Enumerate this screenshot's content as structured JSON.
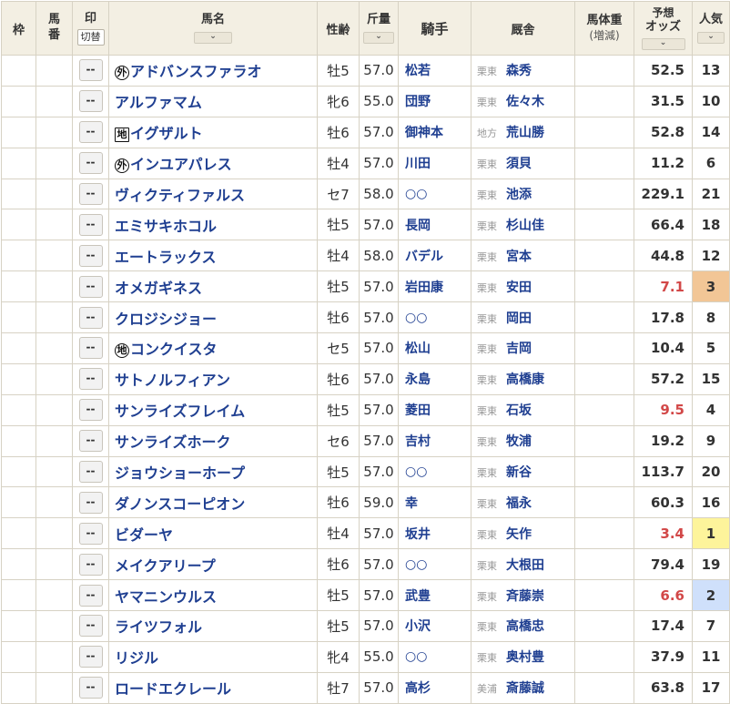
{
  "headers": {
    "waku": "枠",
    "umaban": "馬\n番",
    "mark": "印",
    "mark_toggle": "切替",
    "horse_name": "馬名",
    "sex_age": "性齢",
    "weight": "斤量",
    "jockey": "騎手",
    "stable": "厩舎",
    "body_weight": "馬体重",
    "body_weight_sub": "(増減)",
    "odds_top": "予想",
    "odds_bottom": "オッズ",
    "popularity": "人気",
    "sort_icon": "chevron-down-icon"
  },
  "mark_default": "--",
  "colors": {
    "link_blue": "#1f3f91",
    "odds_hot": "#d24848",
    "pop1": "#fdf49b",
    "pop2": "#cfe0fb",
    "pop3": "#f2c696",
    "header_bg": "#f3efe3"
  },
  "rows": [
    {
      "badge": "外",
      "badge_shape": "circle",
      "name": "アドバンスファラオ",
      "sex_age": "牡5",
      "weight": "57.0",
      "jockey": "松若",
      "region": "栗東",
      "trainer": "森秀",
      "odds": "52.5",
      "pop": "13",
      "hot": false,
      "pop_class": ""
    },
    {
      "badge": "",
      "badge_shape": "",
      "name": "アルファマム",
      "sex_age": "牝6",
      "weight": "55.0",
      "jockey": "団野",
      "region": "栗東",
      "trainer": "佐々木",
      "odds": "31.5",
      "pop": "10",
      "hot": false,
      "pop_class": ""
    },
    {
      "badge": "地",
      "badge_shape": "square",
      "name": "イグザルト",
      "sex_age": "牡6",
      "weight": "57.0",
      "jockey": "御神本",
      "region": "地方",
      "trainer": "荒山勝",
      "odds": "52.8",
      "pop": "14",
      "hot": false,
      "pop_class": ""
    },
    {
      "badge": "外",
      "badge_shape": "circle",
      "name": "インユアパレス",
      "sex_age": "牡4",
      "weight": "57.0",
      "jockey": "川田",
      "region": "栗東",
      "trainer": "須貝",
      "odds": "11.2",
      "pop": "6",
      "hot": false,
      "pop_class": ""
    },
    {
      "badge": "",
      "badge_shape": "",
      "name": "ヴィクティファルス",
      "sex_age": "セ7",
      "weight": "58.0",
      "jockey": "○○",
      "region": "栗東",
      "trainer": "池添",
      "odds": "229.1",
      "pop": "21",
      "hot": false,
      "pop_class": ""
    },
    {
      "badge": "",
      "badge_shape": "",
      "name": "エミサキホコル",
      "sex_age": "牡5",
      "weight": "57.0",
      "jockey": "長岡",
      "region": "栗東",
      "trainer": "杉山佳",
      "odds": "66.4",
      "pop": "18",
      "hot": false,
      "pop_class": ""
    },
    {
      "badge": "",
      "badge_shape": "",
      "name": "エートラックス",
      "sex_age": "牡4",
      "weight": "58.0",
      "jockey": "バデル",
      "region": "栗東",
      "trainer": "宮本",
      "odds": "44.8",
      "pop": "12",
      "hot": false,
      "pop_class": ""
    },
    {
      "badge": "",
      "badge_shape": "",
      "name": "オメガギネス",
      "sex_age": "牡5",
      "weight": "57.0",
      "jockey": "岩田康",
      "region": "栗東",
      "trainer": "安田",
      "odds": "7.1",
      "pop": "3",
      "hot": true,
      "pop_class": "p3"
    },
    {
      "badge": "",
      "badge_shape": "",
      "name": "クロジシジョー",
      "sex_age": "牡6",
      "weight": "57.0",
      "jockey": "○○",
      "region": "栗東",
      "trainer": "岡田",
      "odds": "17.8",
      "pop": "8",
      "hot": false,
      "pop_class": ""
    },
    {
      "badge": "地",
      "badge_shape": "circle",
      "name": "コンクイスタ",
      "sex_age": "セ5",
      "weight": "57.0",
      "jockey": "松山",
      "region": "栗東",
      "trainer": "吉岡",
      "odds": "10.4",
      "pop": "5",
      "hot": false,
      "pop_class": ""
    },
    {
      "badge": "",
      "badge_shape": "",
      "name": "サトノルフィアン",
      "sex_age": "牡6",
      "weight": "57.0",
      "jockey": "永島",
      "region": "栗東",
      "trainer": "高橋康",
      "odds": "57.2",
      "pop": "15",
      "hot": false,
      "pop_class": ""
    },
    {
      "badge": "",
      "badge_shape": "",
      "name": "サンライズフレイム",
      "sex_age": "牡5",
      "weight": "57.0",
      "jockey": "菱田",
      "region": "栗東",
      "trainer": "石坂",
      "odds": "9.5",
      "pop": "4",
      "hot": true,
      "pop_class": ""
    },
    {
      "badge": "",
      "badge_shape": "",
      "name": "サンライズホーク",
      "sex_age": "セ6",
      "weight": "57.0",
      "jockey": "吉村",
      "region": "栗東",
      "trainer": "牧浦",
      "odds": "19.2",
      "pop": "9",
      "hot": false,
      "pop_class": ""
    },
    {
      "badge": "",
      "badge_shape": "",
      "name": "ジョウショーホープ",
      "sex_age": "牡5",
      "weight": "57.0",
      "jockey": "○○",
      "region": "栗東",
      "trainer": "新谷",
      "odds": "113.7",
      "pop": "20",
      "hot": false,
      "pop_class": ""
    },
    {
      "badge": "",
      "badge_shape": "",
      "name": "ダノンスコーピオン",
      "sex_age": "牡6",
      "weight": "59.0",
      "jockey": "幸",
      "region": "栗東",
      "trainer": "福永",
      "odds": "60.3",
      "pop": "16",
      "hot": false,
      "pop_class": ""
    },
    {
      "badge": "",
      "badge_shape": "",
      "name": "ビダーヤ",
      "sex_age": "牡4",
      "weight": "57.0",
      "jockey": "坂井",
      "region": "栗東",
      "trainer": "矢作",
      "odds": "3.4",
      "pop": "1",
      "hot": true,
      "pop_class": "p1"
    },
    {
      "badge": "",
      "badge_shape": "",
      "name": "メイクアリープ",
      "sex_age": "牡6",
      "weight": "57.0",
      "jockey": "○○",
      "region": "栗東",
      "trainer": "大根田",
      "odds": "79.4",
      "pop": "19",
      "hot": false,
      "pop_class": ""
    },
    {
      "badge": "",
      "badge_shape": "",
      "name": "ヤマニンウルス",
      "sex_age": "牡5",
      "weight": "57.0",
      "jockey": "武豊",
      "region": "栗東",
      "trainer": "斉藤崇",
      "odds": "6.6",
      "pop": "2",
      "hot": true,
      "pop_class": "p2"
    },
    {
      "badge": "",
      "badge_shape": "",
      "name": "ライツフォル",
      "sex_age": "牡5",
      "weight": "57.0",
      "jockey": "小沢",
      "region": "栗東",
      "trainer": "高橋忠",
      "odds": "17.4",
      "pop": "7",
      "hot": false,
      "pop_class": ""
    },
    {
      "badge": "",
      "badge_shape": "",
      "name": "リジル",
      "sex_age": "牝4",
      "weight": "55.0",
      "jockey": "○○",
      "region": "栗東",
      "trainer": "奥村豊",
      "odds": "37.9",
      "pop": "11",
      "hot": false,
      "pop_class": ""
    },
    {
      "badge": "",
      "badge_shape": "",
      "name": "ロードエクレール",
      "sex_age": "牡7",
      "weight": "57.0",
      "jockey": "高杉",
      "region": "美浦",
      "trainer": "斎藤誠",
      "odds": "63.8",
      "pop": "17",
      "hot": false,
      "pop_class": ""
    }
  ]
}
